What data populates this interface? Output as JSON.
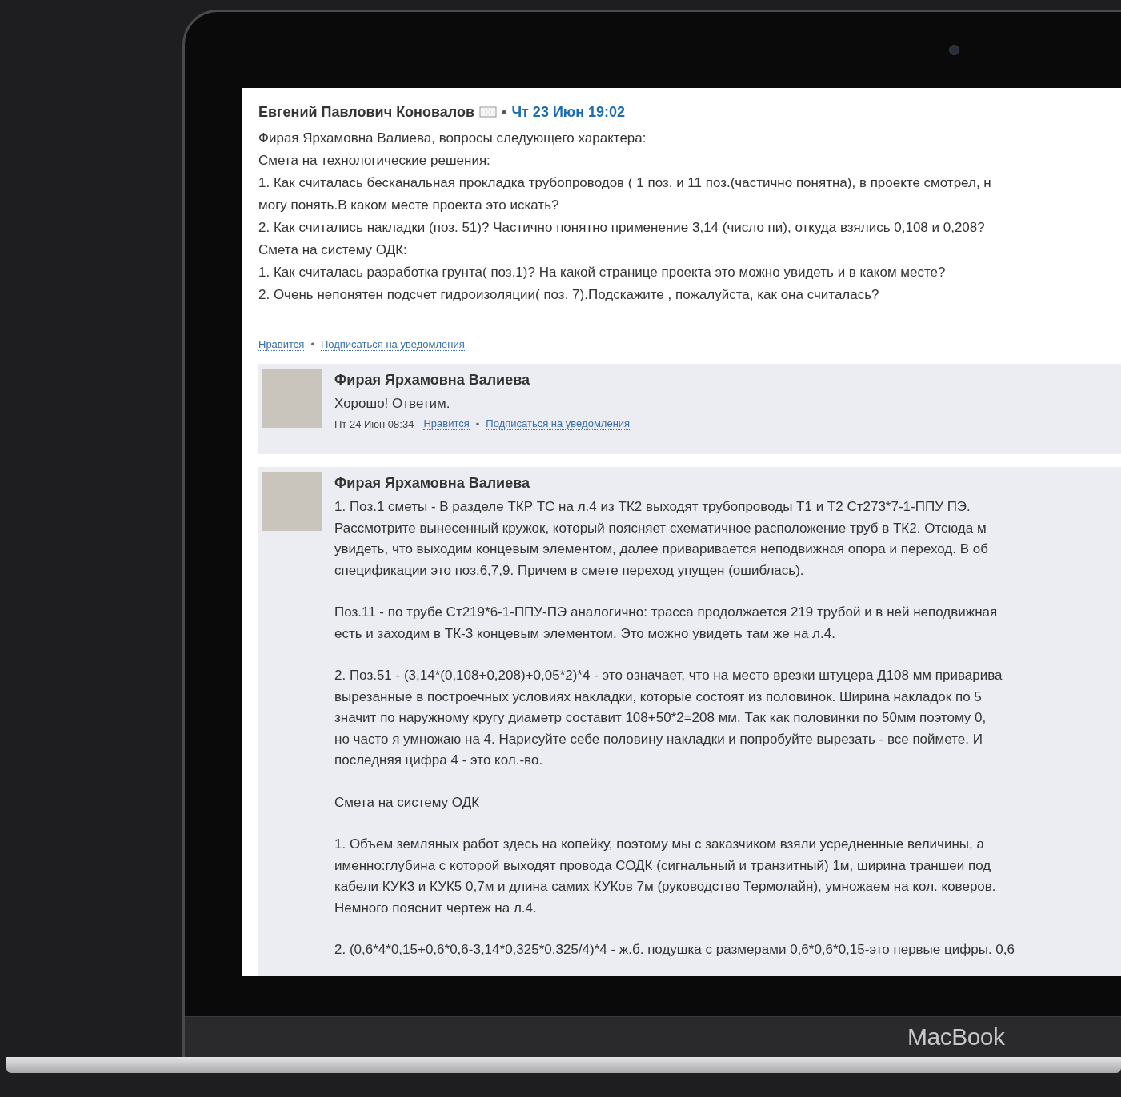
{
  "laptop": {
    "brand": "MacBook"
  },
  "post": {
    "author": "Евгений Павлович Коновалов",
    "separator": "•",
    "date": "Чт 23 Июн 19:02",
    "paragraphs": [
      "Фирая Ярхамовна Валиева, вопросы следующего характера:",
      "Смета на технологические решения:",
      "1. Как считалась бесканальная прокладка трубопроводов ( 1 поз. и 11 поз.(частично понятна), в проекте смотрел, н\nмогу понять.В каком месте проекта это искать?",
      "2. Как считались накладки (поз. 51)? Частично понятно применение 3,14 (число пи), откуда взялись 0,108 и 0,208?",
      "Смета на систему ОДК:",
      "1. Как считалась разработка грунта( поз.1)? На какой странице проекта это можно увидеть и в каком месте?",
      "2. Очень непонятен подсчет гидроизоляции( поз. 7).Подскажите , пожалуйста, как она считалась?"
    ],
    "actions": [
      "Нравится",
      "Подписаться на уведомления"
    ],
    "action_separator": "•"
  },
  "comments": [
    {
      "author": "Фирая Ярхамовна Валиева",
      "paragraphs": [
        "Хорошо! Ответим."
      ],
      "date": "Пт 24 Июн 08:34",
      "actions": [
        "Нравится",
        "Подписаться на уведомления"
      ],
      "action_separator": "•"
    },
    {
      "author": "Фирая Ярхамовна Валиева",
      "paragraphs": [
        "1. Поз.1 сметы - В разделе ТКР ТС на л.4 из ТК2 выходят трубопроводы Т1 и Т2 Ст273*7-1-ППУ ПЭ.\nРассмотрите вынесенный кружок, который поясняет схематичное расположение труб в ТК2. Отсюда м\nувидеть, что выходим концевым элементом, далее приваривается неподвижная опора и переход. В об\nспецификации это поз.6,7,9. Причем в смете переход упущен (ошиблась).",
        "Поз.11 - по трубе Ст219*6-1-ППУ-ПЭ аналогично: трасса продолжается 219 трубой и в ней неподвижная\nесть и заходим в ТК-3 концевым элементом. Это можно увидеть там же на л.4.",
        "2. Поз.51 - (3,14*(0,108+0,208)+0,05*2)*4 - это означает, что на место врезки штуцера Д108 мм приварива\nвырезанные в построечных условиях накладки, которые состоят из половинок. Ширина накладок по 5\nзначит по наружному кругу диаметр составит 108+50*2=208 мм. Так как половинки по 50мм поэтому 0,\nно часто я умножаю на 4. Нарисуйте себе половину накладки и попробуйте вырезать - все поймете. И\nпоследняя цифра 4 - это кол.-во.",
        "Смета на систему ОДК",
        "1. Объем земляных работ здесь на копейку, поэтому мы с заказчиком взяли усредненные величины, а\nименно:глубина с которой выходят провода СОДК (сигнальный и транзитный) 1м, ширина траншеи под\nкабели КУК3 и КУК5 0,7м и длина самих КУКов 7м (руководство Термолайн), умножаем на кол. коверов.\nНемного пояснит чертеж на л.4.",
        "2. (0,6*4*0,15+0,6*0,6-3,14*0,325*0,325/4)*4 - ж.б. подушка с размерами 0,6*0,6*0,15-это первые цифры. 0,6"
      ]
    }
  ]
}
